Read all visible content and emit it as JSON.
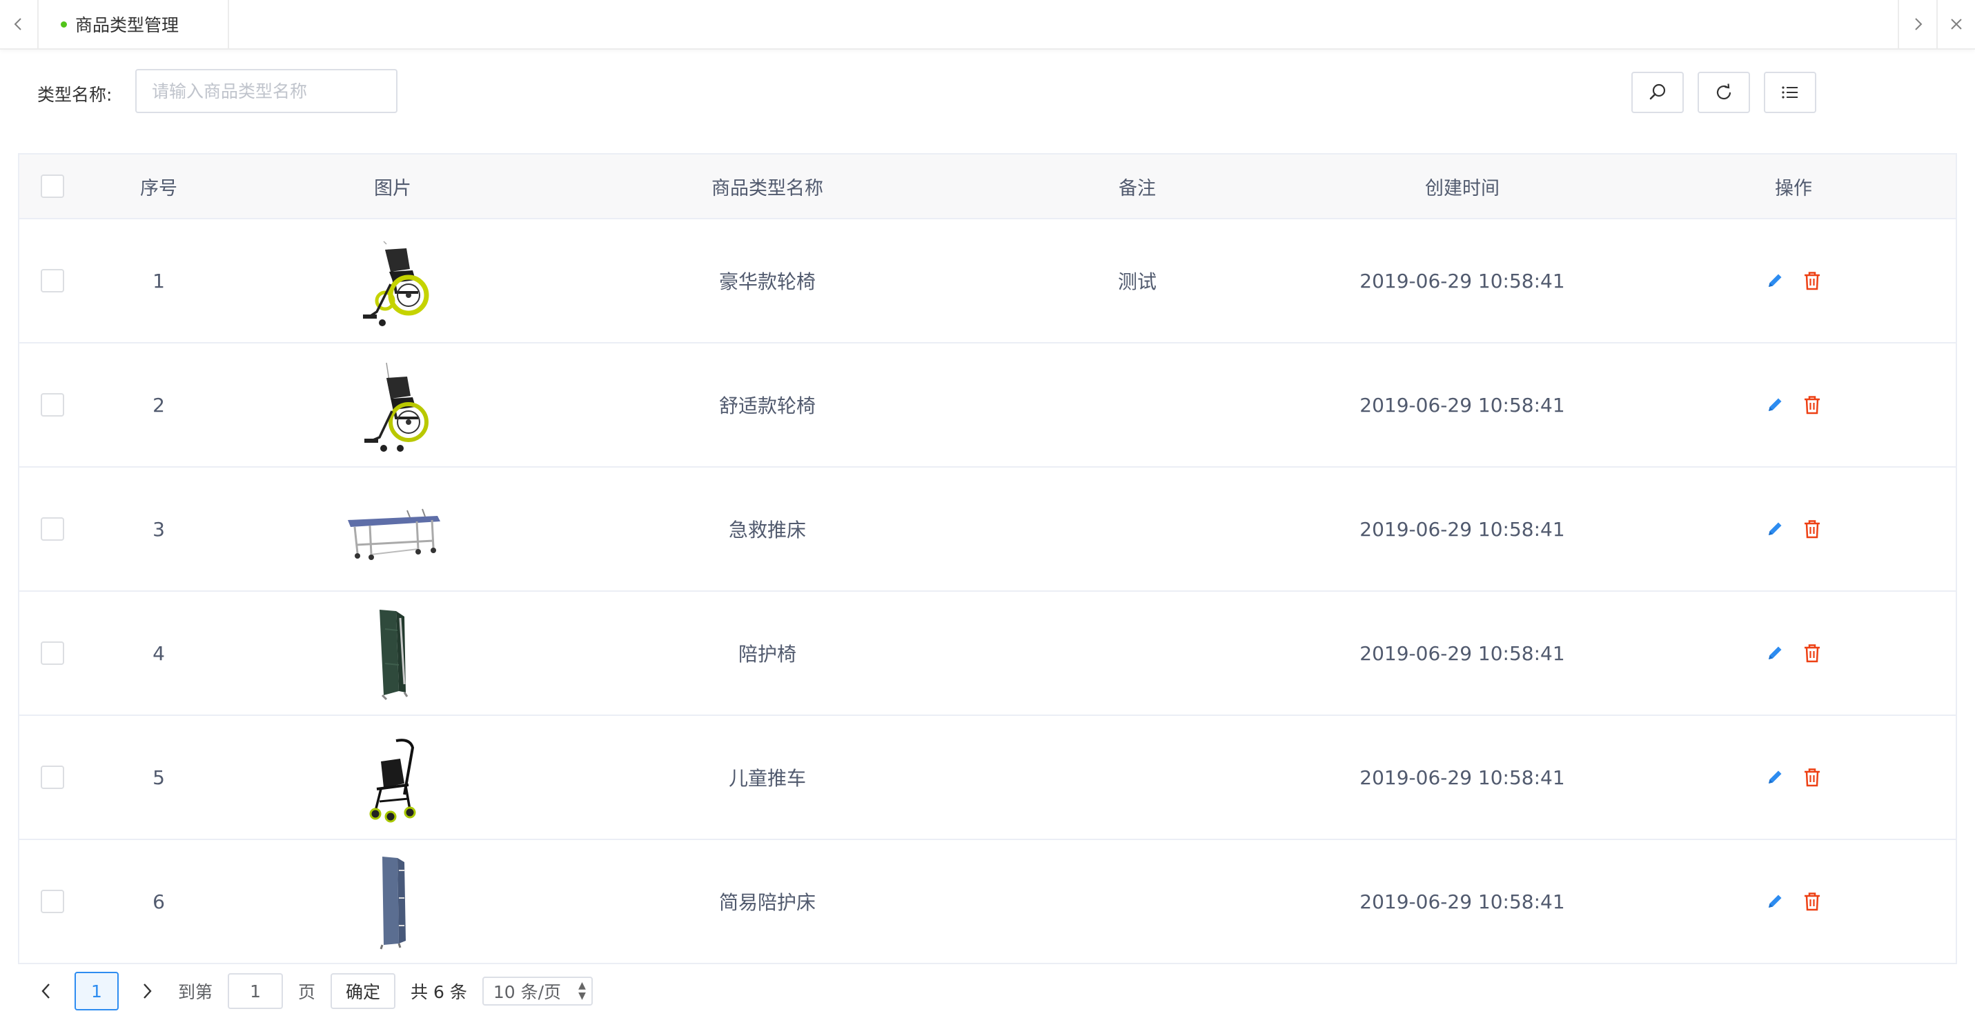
{
  "tab": {
    "title": "商品类型管理"
  },
  "search": {
    "label": "类型名称:",
    "placeholder": "请输入商品类型名称",
    "value": ""
  },
  "table": {
    "headers": {
      "index": "序号",
      "image": "图片",
      "name": "商品类型名称",
      "note": "备注",
      "created": "创建时间",
      "ops": "操作"
    },
    "rows": [
      {
        "index": "1",
        "image": "wheelchair-deluxe",
        "name": "豪华款轮椅",
        "note": "测试",
        "created": "2019-06-29 10:58:41"
      },
      {
        "index": "2",
        "image": "wheelchair-comfort",
        "name": "舒适款轮椅",
        "note": "",
        "created": "2019-06-29 10:58:41"
      },
      {
        "index": "3",
        "image": "stretcher",
        "name": "急救推床",
        "note": "",
        "created": "2019-06-29 10:58:41"
      },
      {
        "index": "4",
        "image": "folding-chair-green",
        "name": "陪护椅",
        "note": "",
        "created": "2019-06-29 10:58:41"
      },
      {
        "index": "5",
        "image": "stroller",
        "name": "儿童推车",
        "note": "",
        "created": "2019-06-29 10:58:41"
      },
      {
        "index": "6",
        "image": "folding-bed-blue",
        "name": "简易陪护床",
        "note": "",
        "created": "2019-06-29 10:58:41"
      }
    ]
  },
  "pagination": {
    "current": "1",
    "goto_label": "到第",
    "goto_value": "1",
    "page_unit": "页",
    "confirm": "确定",
    "total": "共 6 条",
    "page_size": "10 条/页"
  },
  "colors": {
    "accent": "#2d8cf0",
    "danger": "#ed4014",
    "active_dot": "#52c41a"
  }
}
